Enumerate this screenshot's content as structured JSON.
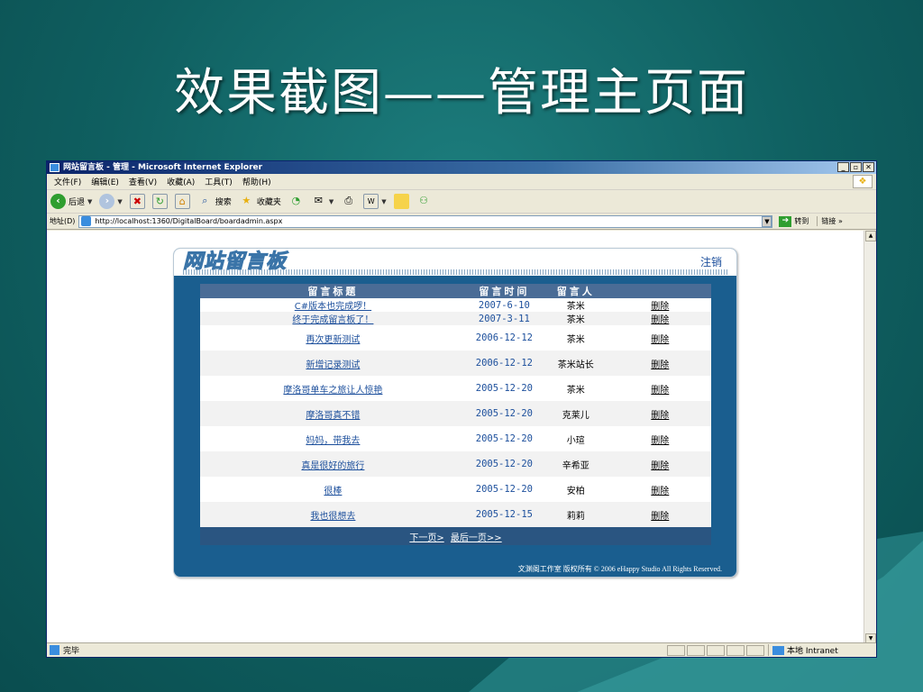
{
  "slide": {
    "title": "效果截图——管理主页面"
  },
  "window": {
    "title": "网站留言板 - 管理 - Microsoft Internet Explorer",
    "controls": [
      "_",
      "▫",
      "✕"
    ]
  },
  "menu": [
    "文件(F)",
    "编辑(E)",
    "查看(V)",
    "收藏(A)",
    "工具(T)",
    "帮助(H)"
  ],
  "toolbar": {
    "back": "后退",
    "search": "搜索",
    "favorites": "收藏夹"
  },
  "address": {
    "label": "地址(D)",
    "url": "http://localhost:1360/DigitalBoard/boardadmin.aspx",
    "go": "转到",
    "links": "链接"
  },
  "board": {
    "logo": "网站留言板",
    "logout": "注销",
    "headers": [
      "留言标题",
      "留言时间",
      "留言人",
      ""
    ],
    "rows": [
      {
        "title": "C#版本也完成啰！",
        "time": "2007-6-10",
        "author": "茶米",
        "action": "删除"
      },
      {
        "title": "终于完成留言板了！",
        "time": "2007-3-11",
        "author": "茶米",
        "action": "删除"
      },
      {
        "title": "再次更新测试",
        "time": "2006-12-12",
        "author": "茶米",
        "action": "删除"
      },
      {
        "title": "新增记录测试",
        "time": "2006-12-12",
        "author": "茶米站长",
        "action": "删除"
      },
      {
        "title": "摩洛哥单车之旅让人惊艳",
        "time": "2005-12-20",
        "author": "茶米",
        "action": "删除"
      },
      {
        "title": "摩洛哥真不错",
        "time": "2005-12-20",
        "author": "克莱儿",
        "action": "删除"
      },
      {
        "title": "妈妈，带我去",
        "time": "2005-12-20",
        "author": "小瑄",
        "action": "删除"
      },
      {
        "title": "真是很好的旅行",
        "time": "2005-12-20",
        "author": "辛希亚",
        "action": "删除"
      },
      {
        "title": "很棒",
        "time": "2005-12-20",
        "author": "安柏",
        "action": "删除"
      },
      {
        "title": "我也很想去",
        "time": "2005-12-15",
        "author": "莉莉",
        "action": "删除"
      }
    ],
    "pager": {
      "next": "下一页>",
      "last": "最后一页>>"
    },
    "copyright": "文渊阁工作室 版权所有 © 2006 eHappy Studio All Rights Reserved."
  },
  "status": {
    "text": "完毕",
    "zone": "本地 Intranet"
  }
}
